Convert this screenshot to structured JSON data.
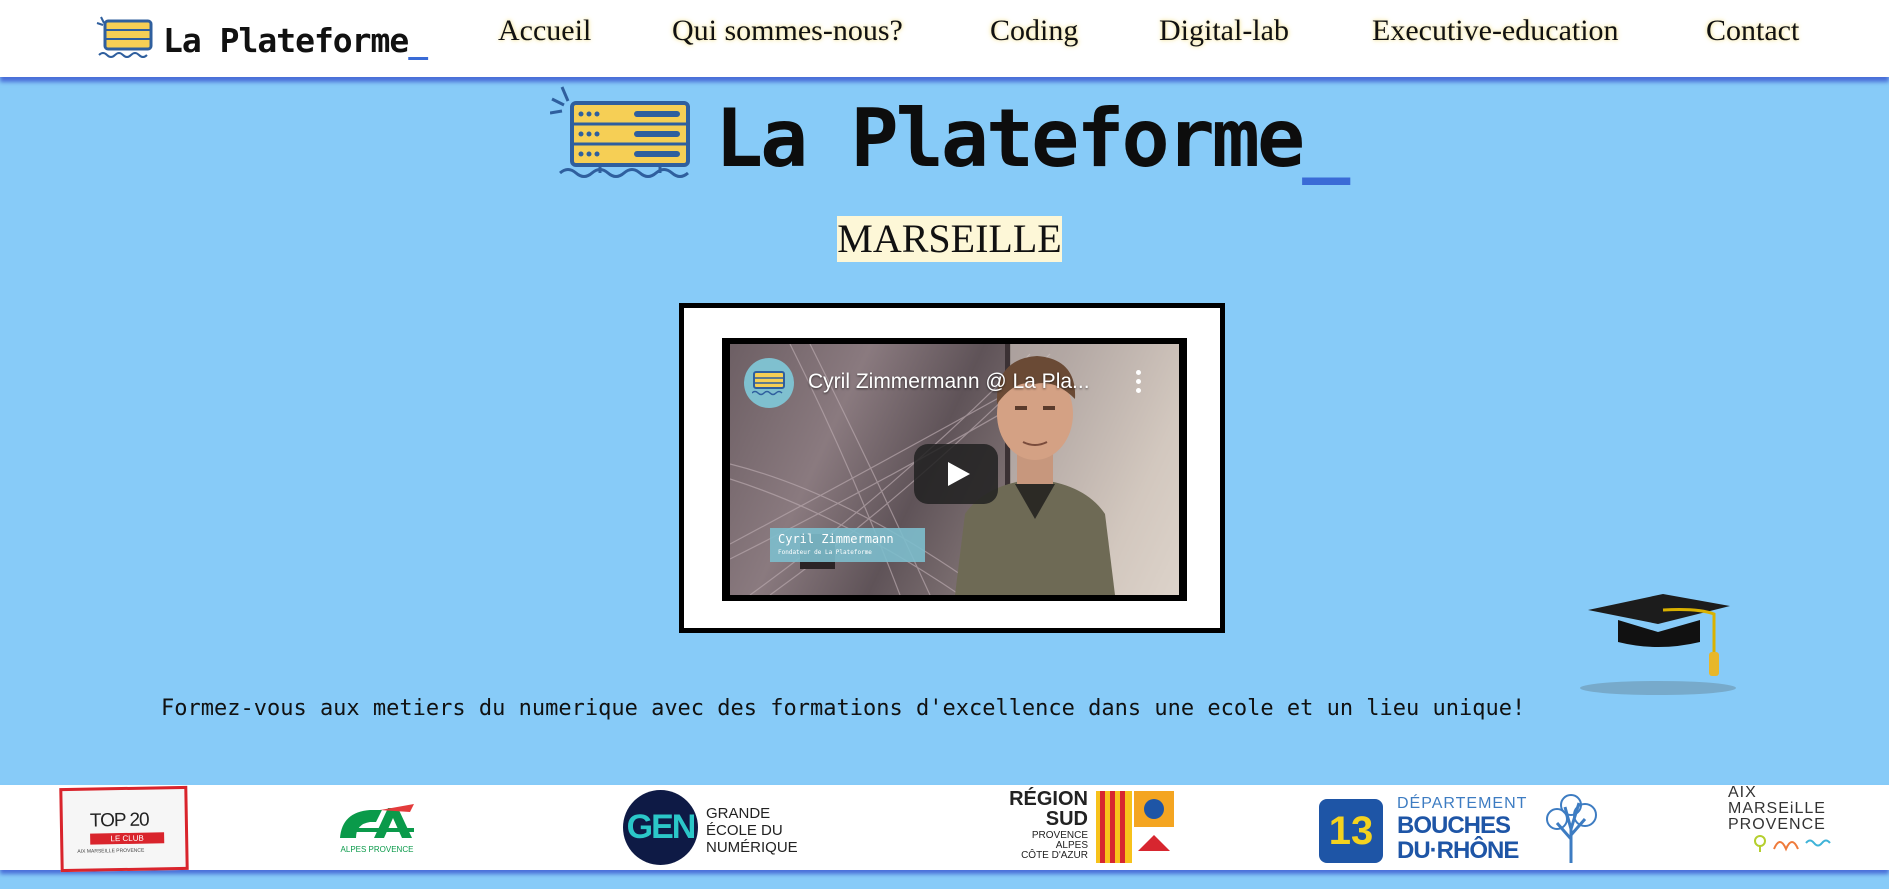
{
  "header": {
    "brand": {
      "name": "La Plateforme",
      "cursor": "_"
    },
    "nav": [
      {
        "label": "Accueil"
      },
      {
        "label": "Qui sommes-nous?"
      },
      {
        "label": "Coding"
      },
      {
        "label": "Digital-lab"
      },
      {
        "label": "Executive-education"
      },
      {
        "label": "Contact"
      }
    ]
  },
  "hero": {
    "title": "La Plateforme",
    "cursor": "_",
    "city": "MARSEILLE"
  },
  "video": {
    "title": "Cyril Zimmermann @ La Pla...",
    "lower_third_name": "Cyril Zimmermann",
    "lower_third_role": "Fondateur de La Plateforme",
    "play_icon": "play-icon",
    "menu_icon": "more-vert-icon"
  },
  "tagline": "Formez-vous aux metiers du numerique avec des formations d'excellence dans une ecole et un lieu unique!",
  "partners": {
    "top20": {
      "title": "TOP 20",
      "badge": "LE CLUB",
      "sub": "AIX MARSEILLE PROVENCE"
    },
    "credit_agricole": {
      "caption": "ALPES PROVENCE"
    },
    "gen": {
      "mark": "GEN",
      "lines": [
        "GRANDE",
        "ÉCOLE DU",
        "NUMÉRIQUE"
      ]
    },
    "region_sud": {
      "lines": [
        "RÉGION",
        "SUD"
      ],
      "sub": [
        "PROVENCE",
        "ALPES",
        "CÔTE D'AZUR"
      ]
    },
    "bouches_du_rhone": {
      "number": "13",
      "line1": "DÉPARTEMENT",
      "line2": "BOUCHES",
      "line3": "DU·RHÔNE"
    },
    "aix_marseille": {
      "lines": [
        "AIX",
        "MARSEiLLE",
        "PROVENCE"
      ]
    }
  },
  "colors": {
    "page_bg": "#87cbf8",
    "accent_blue": "#3a6bd6",
    "server_yellow": "#f6cf55",
    "server_blue": "#2f5f9e",
    "nav_glow": "#f5e8a8"
  }
}
